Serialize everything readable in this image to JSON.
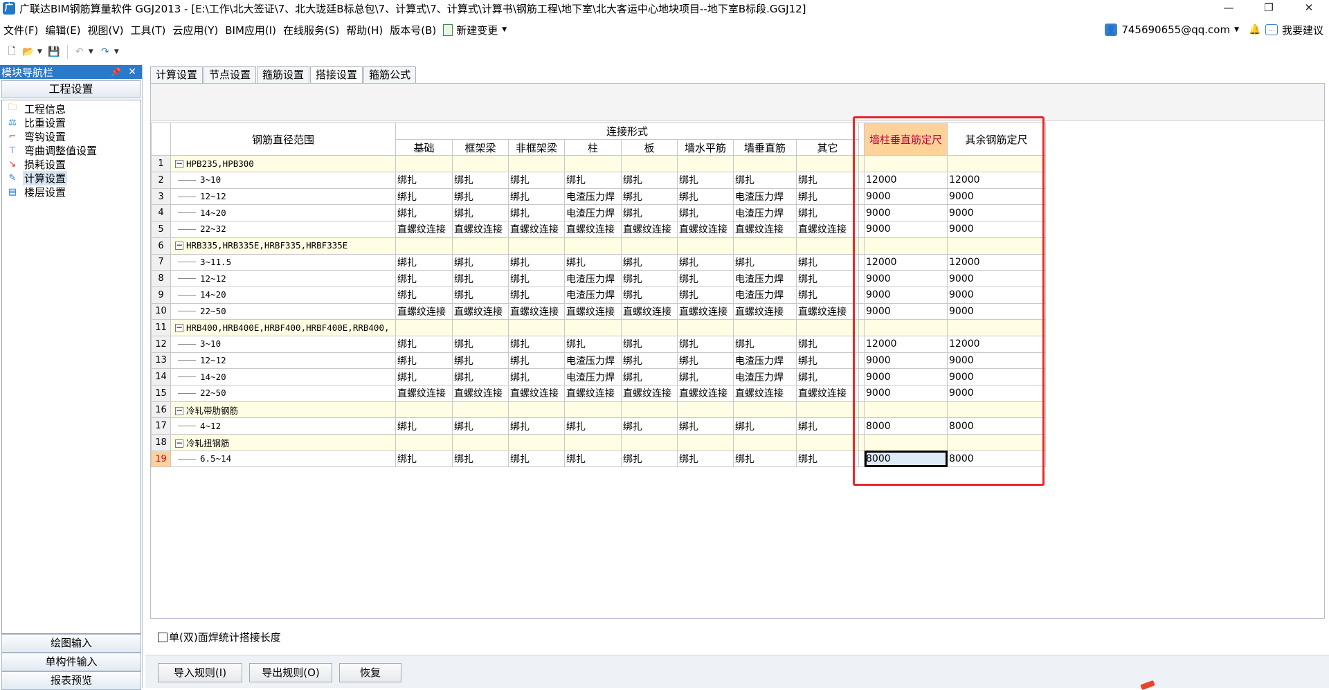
{
  "window": {
    "title": "广联达BIM钢筋算量软件 GGJ2013 - [E:\\工作\\北大签证\\7、北大珑廷B标总包\\7、计算式\\7、计算式\\计算书\\钢筋工程\\地下室\\北大客运中心地块项目--地下室B标段.GGJ12]",
    "minimize": "—",
    "restore": "❐",
    "close": "✕"
  },
  "menu": {
    "items": [
      "文件(F)",
      "编辑(E)",
      "视图(V)",
      "工具(T)",
      "云应用(Y)",
      "BIM应用(I)",
      "在线服务(S)",
      "帮助(H)",
      "版本号(B)"
    ],
    "new_change": "新建变更",
    "account": "745690655@qq.com",
    "feedback": "我要建议"
  },
  "nav": {
    "title": "模块导航栏",
    "section": "工程设置",
    "items": [
      {
        "label": "工程信息",
        "icon": "folder-icon"
      },
      {
        "label": "比重设置",
        "icon": "weight-icon"
      },
      {
        "label": "弯钩设置",
        "icon": "hook-icon"
      },
      {
        "label": "弯曲调整值设置",
        "icon": "bend-icon"
      },
      {
        "label": "损耗设置",
        "icon": "loss-icon"
      },
      {
        "label": "计算设置",
        "icon": "calc-icon"
      },
      {
        "label": "楼层设置",
        "icon": "floor-icon"
      }
    ],
    "selected": 5,
    "bottom": [
      "绘图输入",
      "单构件输入",
      "报表预览"
    ]
  },
  "tabs": [
    "计算设置",
    "节点设置",
    "箍筋设置",
    "搭接设置",
    "箍筋公式"
  ],
  "active_tab": 3,
  "table": {
    "range_header": "钢筋直径范围",
    "connection_header": "连接形式",
    "columns": [
      "基础",
      "框架梁",
      "非框架梁",
      "柱",
      "板",
      "墙水平筋",
      "墙垂直筋",
      "其它"
    ],
    "length_headers": [
      "墙柱垂直筋定尺",
      "其余钢筋定尺"
    ],
    "rows": [
      {
        "n": "1",
        "group": true,
        "range": "HPB235,HPB300"
      },
      {
        "n": "2",
        "range": "3~10",
        "conn": [
          "绑扎",
          "绑扎",
          "绑扎",
          "绑扎",
          "绑扎",
          "绑扎",
          "绑扎",
          "绑扎"
        ],
        "len": [
          "12000",
          "12000"
        ]
      },
      {
        "n": "3",
        "range": "12~12",
        "conn": [
          "绑扎",
          "绑扎",
          "绑扎",
          "电渣压力焊",
          "绑扎",
          "绑扎",
          "电渣压力焊",
          "绑扎"
        ],
        "len": [
          "9000",
          "9000"
        ]
      },
      {
        "n": "4",
        "range": "14~20",
        "conn": [
          "绑扎",
          "绑扎",
          "绑扎",
          "电渣压力焊",
          "绑扎",
          "绑扎",
          "电渣压力焊",
          "绑扎"
        ],
        "len": [
          "9000",
          "9000"
        ]
      },
      {
        "n": "5",
        "range": "22~32",
        "conn": [
          "直螺纹连接",
          "直螺纹连接",
          "直螺纹连接",
          "直螺纹连接",
          "直螺纹连接",
          "直螺纹连接",
          "直螺纹连接",
          "直螺纹连接"
        ],
        "len": [
          "9000",
          "9000"
        ]
      },
      {
        "n": "6",
        "group": true,
        "range": "HRB335,HRB335E,HRBF335,HRBF335E"
      },
      {
        "n": "7",
        "range": "3~11.5",
        "conn": [
          "绑扎",
          "绑扎",
          "绑扎",
          "绑扎",
          "绑扎",
          "绑扎",
          "绑扎",
          "绑扎"
        ],
        "len": [
          "12000",
          "12000"
        ]
      },
      {
        "n": "8",
        "range": "12~12",
        "conn": [
          "绑扎",
          "绑扎",
          "绑扎",
          "电渣压力焊",
          "绑扎",
          "绑扎",
          "电渣压力焊",
          "绑扎"
        ],
        "len": [
          "9000",
          "9000"
        ]
      },
      {
        "n": "9",
        "range": "14~20",
        "conn": [
          "绑扎",
          "绑扎",
          "绑扎",
          "电渣压力焊",
          "绑扎",
          "绑扎",
          "电渣压力焊",
          "绑扎"
        ],
        "len": [
          "9000",
          "9000"
        ]
      },
      {
        "n": "10",
        "range": "22~50",
        "conn": [
          "直螺纹连接",
          "直螺纹连接",
          "直螺纹连接",
          "直螺纹连接",
          "直螺纹连接",
          "直螺纹连接",
          "直螺纹连接",
          "直螺纹连接"
        ],
        "len": [
          "9000",
          "9000"
        ]
      },
      {
        "n": "11",
        "group": true,
        "range": "HRB400,HRB400E,HRBF400,HRBF400E,RRB400,"
      },
      {
        "n": "12",
        "range": "3~10",
        "conn": [
          "绑扎",
          "绑扎",
          "绑扎",
          "绑扎",
          "绑扎",
          "绑扎",
          "绑扎",
          "绑扎"
        ],
        "len": [
          "12000",
          "12000"
        ]
      },
      {
        "n": "13",
        "range": "12~12",
        "conn": [
          "绑扎",
          "绑扎",
          "绑扎",
          "电渣压力焊",
          "绑扎",
          "绑扎",
          "电渣压力焊",
          "绑扎"
        ],
        "len": [
          "9000",
          "9000"
        ]
      },
      {
        "n": "14",
        "range": "14~20",
        "conn": [
          "绑扎",
          "绑扎",
          "绑扎",
          "电渣压力焊",
          "绑扎",
          "绑扎",
          "电渣压力焊",
          "绑扎"
        ],
        "len": [
          "9000",
          "9000"
        ]
      },
      {
        "n": "15",
        "range": "22~50",
        "conn": [
          "直螺纹连接",
          "直螺纹连接",
          "直螺纹连接",
          "直螺纹连接",
          "直螺纹连接",
          "直螺纹连接",
          "直螺纹连接",
          "直螺纹连接"
        ],
        "len": [
          "9000",
          "9000"
        ]
      },
      {
        "n": "16",
        "group": true,
        "range": "冷轧带肋钢筋"
      },
      {
        "n": "17",
        "range": "4~12",
        "conn": [
          "绑扎",
          "绑扎",
          "绑扎",
          "绑扎",
          "绑扎",
          "绑扎",
          "绑扎",
          "绑扎"
        ],
        "len": [
          "8000",
          "8000"
        ]
      },
      {
        "n": "18",
        "group": true,
        "range": "冷轧扭钢筋"
      },
      {
        "n": "19",
        "range": "6.5~14",
        "conn": [
          "绑扎",
          "绑扎",
          "绑扎",
          "绑扎",
          "绑扎",
          "绑扎",
          "绑扎",
          "绑扎"
        ],
        "len": [
          "8000",
          "8000"
        ],
        "current": true
      }
    ]
  },
  "checkbox_label": "单(双)面焊统计搭接长度",
  "buttons": [
    "导入规则(I)",
    "导出规则(O)",
    "恢复"
  ],
  "colors": {
    "accent": "#2b79c9",
    "highlight_header": "#ffd29a",
    "annotation_red": "#e8262b",
    "group_row": "#fffde3"
  }
}
